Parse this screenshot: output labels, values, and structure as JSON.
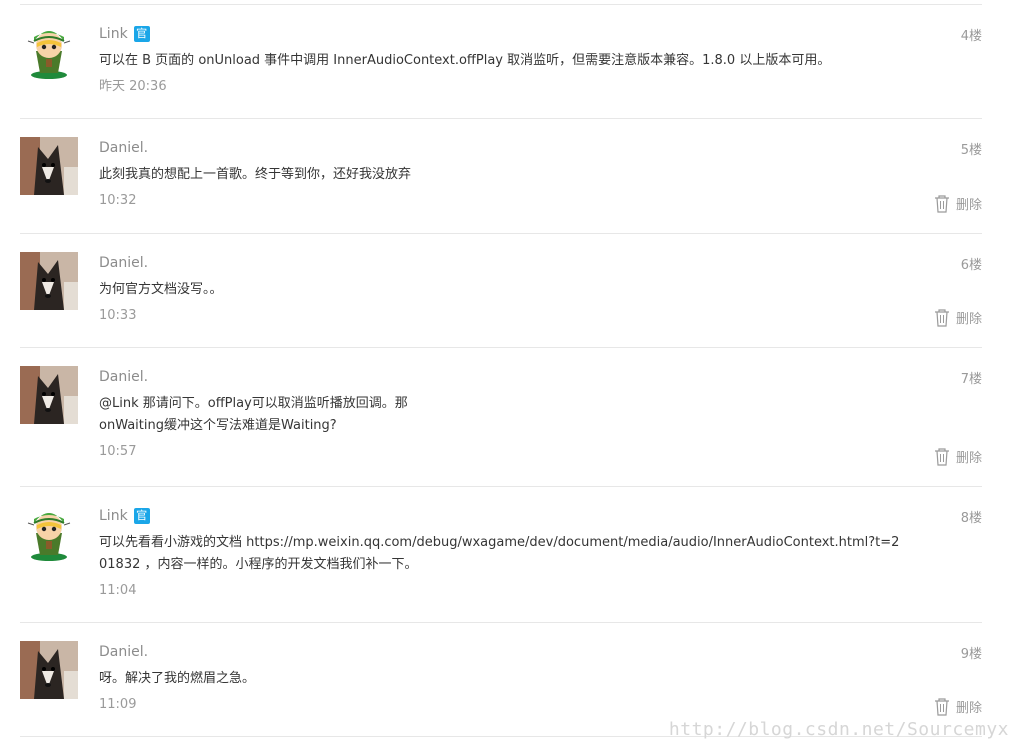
{
  "comments": [
    {
      "author": "Link",
      "official_badge": "官",
      "floor": "4楼",
      "content": "可以在 B 页面的 onUnload 事件中调用 InnerAudioContext.offPlay 取消监听，但需要注意版本兼容。1.8.0 以上版本可用。",
      "time": "昨天 20:36",
      "avatar": "link-avatar"
    },
    {
      "author": "Daniel.",
      "floor": "5楼",
      "content": "此刻我真的想配上一首歌。终于等到你，还好我没放弃",
      "time": "10:32",
      "delete_label": "删除",
      "avatar": "dog-avatar"
    },
    {
      "author": "Daniel.",
      "floor": "6楼",
      "content": "为何官方文档没写。。",
      "time": "10:33",
      "delete_label": "删除",
      "avatar": "dog-avatar"
    },
    {
      "author": "Daniel.",
      "floor": "7楼",
      "content_lines": [
        "@Link 那请问下。offPlay可以取消监听播放回调。那",
        "onWaiting缓冲这个写法难道是Waiting?"
      ],
      "time": "10:57",
      "delete_label": "删除",
      "avatar": "dog-avatar"
    },
    {
      "author": "Link",
      "official_badge": "官",
      "floor": "8楼",
      "content_lines": [
        "可以先看看小游戏的文档 https://mp.weixin.qq.com/debug/wxagame/dev/document/media/audio/InnerAudioContext.html?t=2",
        "01832 ，内容一样的。小程序的开发文档我们补一下。"
      ],
      "time": "11:04",
      "avatar": "link-avatar"
    },
    {
      "author": "Daniel.",
      "floor": "9楼",
      "content": "呀。解决了我的燃眉之急。",
      "time": "11:09",
      "delete_label": "删除",
      "avatar": "dog-avatar"
    }
  ],
  "watermark": "http://blog.csdn.net/Sourcemyx",
  "colors": {
    "badge": "#1aa6e8",
    "meta_text": "#9a9a9a",
    "divider": "#e7e7e7"
  }
}
